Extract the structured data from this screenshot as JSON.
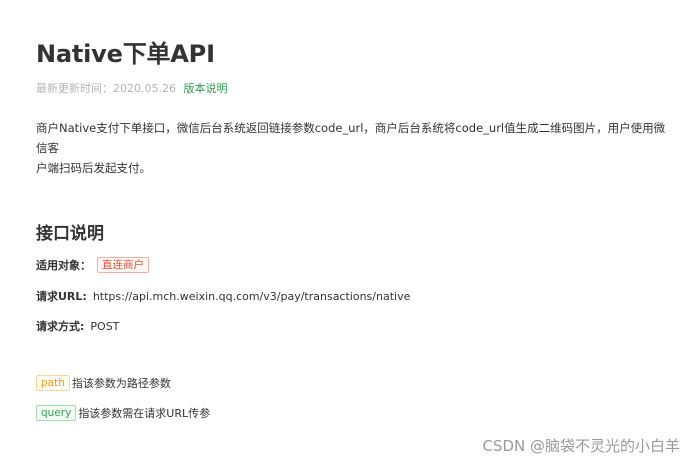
{
  "page": {
    "title": "Native下单API",
    "updated_label": "最新更新时间：2020.05.26",
    "version_link": "版本说明",
    "intro_line1": "商户Native支付下单接口，微信后台系统返回链接参数code_url，商户后台系统将code_url值生成二维码图片，用户使用微信客",
    "intro_line2": "户端扫码后发起支付。"
  },
  "section": {
    "title": "接口说明",
    "applicable_label": "适用对象：",
    "applicable_tag": "直连商户",
    "url_label": "请求URL:",
    "url_value": "https://api.mch.weixin.qq.com/v3/pay/transactions/native",
    "method_label": "请求方式:",
    "method_value": "POST"
  },
  "legend": {
    "path_tag": "path",
    "path_text": "指该参数为路径参数",
    "query_tag": "query",
    "query_text": "指该参数需在请求URL传参"
  },
  "watermark": {
    "text": "CSDN @脑袋不灵光的小白羊"
  },
  "colors": {
    "accent_green": "#30a14e",
    "tag_red": "#e6553a",
    "tag_orange": "#f0a020"
  }
}
